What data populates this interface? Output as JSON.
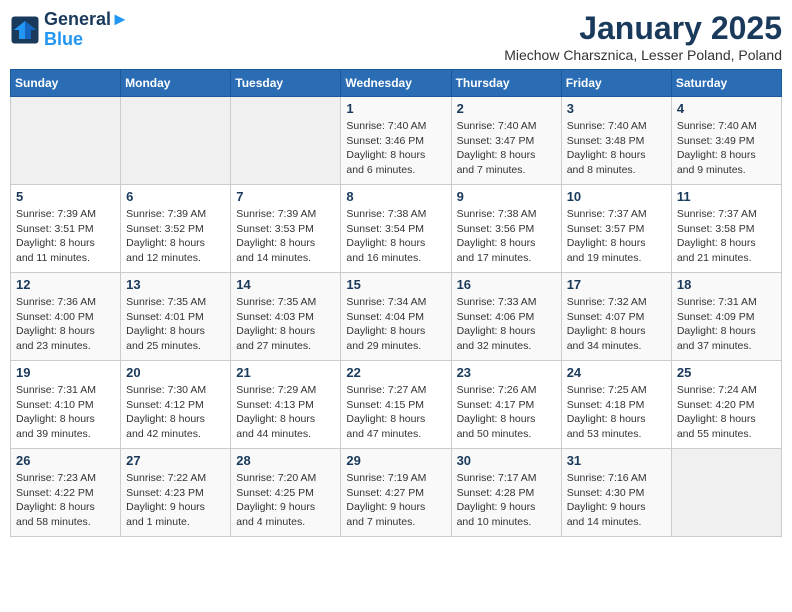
{
  "header": {
    "logo_line1": "General",
    "logo_line2": "Blue",
    "month": "January 2025",
    "location": "Miechow Charsznica, Lesser Poland, Poland"
  },
  "weekdays": [
    "Sunday",
    "Monday",
    "Tuesday",
    "Wednesday",
    "Thursday",
    "Friday",
    "Saturday"
  ],
  "weeks": [
    [
      {
        "day": "",
        "info": ""
      },
      {
        "day": "",
        "info": ""
      },
      {
        "day": "",
        "info": ""
      },
      {
        "day": "1",
        "info": "Sunrise: 7:40 AM\nSunset: 3:46 PM\nDaylight: 8 hours and 6 minutes."
      },
      {
        "day": "2",
        "info": "Sunrise: 7:40 AM\nSunset: 3:47 PM\nDaylight: 8 hours and 7 minutes."
      },
      {
        "day": "3",
        "info": "Sunrise: 7:40 AM\nSunset: 3:48 PM\nDaylight: 8 hours and 8 minutes."
      },
      {
        "day": "4",
        "info": "Sunrise: 7:40 AM\nSunset: 3:49 PM\nDaylight: 8 hours and 9 minutes."
      }
    ],
    [
      {
        "day": "5",
        "info": "Sunrise: 7:39 AM\nSunset: 3:51 PM\nDaylight: 8 hours and 11 minutes."
      },
      {
        "day": "6",
        "info": "Sunrise: 7:39 AM\nSunset: 3:52 PM\nDaylight: 8 hours and 12 minutes."
      },
      {
        "day": "7",
        "info": "Sunrise: 7:39 AM\nSunset: 3:53 PM\nDaylight: 8 hours and 14 minutes."
      },
      {
        "day": "8",
        "info": "Sunrise: 7:38 AM\nSunset: 3:54 PM\nDaylight: 8 hours and 16 minutes."
      },
      {
        "day": "9",
        "info": "Sunrise: 7:38 AM\nSunset: 3:56 PM\nDaylight: 8 hours and 17 minutes."
      },
      {
        "day": "10",
        "info": "Sunrise: 7:37 AM\nSunset: 3:57 PM\nDaylight: 8 hours and 19 minutes."
      },
      {
        "day": "11",
        "info": "Sunrise: 7:37 AM\nSunset: 3:58 PM\nDaylight: 8 hours and 21 minutes."
      }
    ],
    [
      {
        "day": "12",
        "info": "Sunrise: 7:36 AM\nSunset: 4:00 PM\nDaylight: 8 hours and 23 minutes."
      },
      {
        "day": "13",
        "info": "Sunrise: 7:35 AM\nSunset: 4:01 PM\nDaylight: 8 hours and 25 minutes."
      },
      {
        "day": "14",
        "info": "Sunrise: 7:35 AM\nSunset: 4:03 PM\nDaylight: 8 hours and 27 minutes."
      },
      {
        "day": "15",
        "info": "Sunrise: 7:34 AM\nSunset: 4:04 PM\nDaylight: 8 hours and 29 minutes."
      },
      {
        "day": "16",
        "info": "Sunrise: 7:33 AM\nSunset: 4:06 PM\nDaylight: 8 hours and 32 minutes."
      },
      {
        "day": "17",
        "info": "Sunrise: 7:32 AM\nSunset: 4:07 PM\nDaylight: 8 hours and 34 minutes."
      },
      {
        "day": "18",
        "info": "Sunrise: 7:31 AM\nSunset: 4:09 PM\nDaylight: 8 hours and 37 minutes."
      }
    ],
    [
      {
        "day": "19",
        "info": "Sunrise: 7:31 AM\nSunset: 4:10 PM\nDaylight: 8 hours and 39 minutes."
      },
      {
        "day": "20",
        "info": "Sunrise: 7:30 AM\nSunset: 4:12 PM\nDaylight: 8 hours and 42 minutes."
      },
      {
        "day": "21",
        "info": "Sunrise: 7:29 AM\nSunset: 4:13 PM\nDaylight: 8 hours and 44 minutes."
      },
      {
        "day": "22",
        "info": "Sunrise: 7:27 AM\nSunset: 4:15 PM\nDaylight: 8 hours and 47 minutes."
      },
      {
        "day": "23",
        "info": "Sunrise: 7:26 AM\nSunset: 4:17 PM\nDaylight: 8 hours and 50 minutes."
      },
      {
        "day": "24",
        "info": "Sunrise: 7:25 AM\nSunset: 4:18 PM\nDaylight: 8 hours and 53 minutes."
      },
      {
        "day": "25",
        "info": "Sunrise: 7:24 AM\nSunset: 4:20 PM\nDaylight: 8 hours and 55 minutes."
      }
    ],
    [
      {
        "day": "26",
        "info": "Sunrise: 7:23 AM\nSunset: 4:22 PM\nDaylight: 8 hours and 58 minutes."
      },
      {
        "day": "27",
        "info": "Sunrise: 7:22 AM\nSunset: 4:23 PM\nDaylight: 9 hours and 1 minute."
      },
      {
        "day": "28",
        "info": "Sunrise: 7:20 AM\nSunset: 4:25 PM\nDaylight: 9 hours and 4 minutes."
      },
      {
        "day": "29",
        "info": "Sunrise: 7:19 AM\nSunset: 4:27 PM\nDaylight: 9 hours and 7 minutes."
      },
      {
        "day": "30",
        "info": "Sunrise: 7:17 AM\nSunset: 4:28 PM\nDaylight: 9 hours and 10 minutes."
      },
      {
        "day": "31",
        "info": "Sunrise: 7:16 AM\nSunset: 4:30 PM\nDaylight: 9 hours and 14 minutes."
      },
      {
        "day": "",
        "info": ""
      }
    ]
  ]
}
